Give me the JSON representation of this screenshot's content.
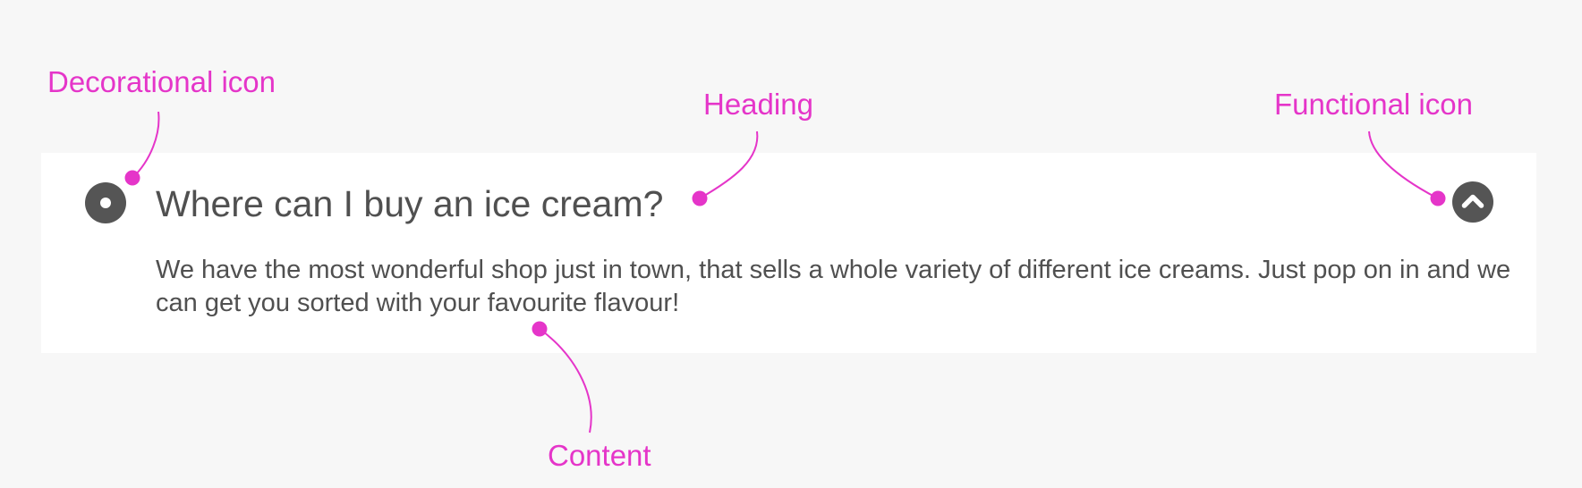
{
  "annotations": {
    "decorational_icon": "Decorational icon",
    "heading": "Heading",
    "functional_icon": "Functional icon",
    "content": "Content"
  },
  "accordion": {
    "heading": "Where can I buy an ice cream?",
    "content": "We have the most wonderful shop just in town, that sells a whole variety of different ice creams. Just pop on in and we can get you sorted with your favourite flavour!",
    "decorational_icon": "circle-dot-icon",
    "functional_icon": "chevron-up-icon"
  },
  "colors": {
    "annotation": "#e535c9",
    "icon": "#555555",
    "text": "#505050",
    "card": "#ffffff",
    "background": "#f7f7f7"
  }
}
